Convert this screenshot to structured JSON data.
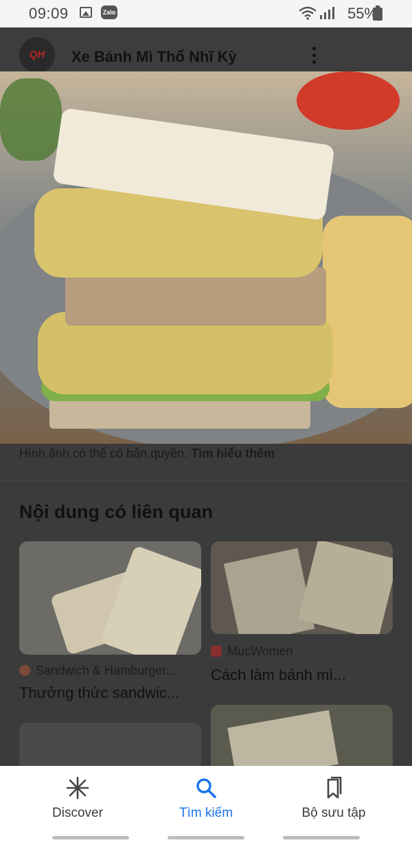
{
  "status_bar": {
    "time": "09:09",
    "battery": "55%"
  },
  "header": {
    "logo_text": "QH",
    "title": "Xe Bánh Mì Thổ Nhĩ Kỳ"
  },
  "caption": {
    "text": "Hình ảnh có thể có bản quyền.",
    "link": "Tìm hiểu thêm"
  },
  "related": {
    "heading": "Nội dung có liên quan",
    "cards": [
      {
        "source": "Sandwich & Hamburger...",
        "title": "Thưởng thức sandwic..."
      },
      {
        "source": "MucWomen",
        "title": "Cách làm bánh mì..."
      }
    ]
  },
  "bottom_nav": [
    {
      "label": "Discover",
      "icon": "asterisk-icon"
    },
    {
      "label": "Tìm kiếm",
      "icon": "search-icon",
      "active": true
    },
    {
      "label": "Bộ sưu tập",
      "icon": "collections-icon"
    }
  ],
  "colors": {
    "active": "#1a73e8"
  }
}
